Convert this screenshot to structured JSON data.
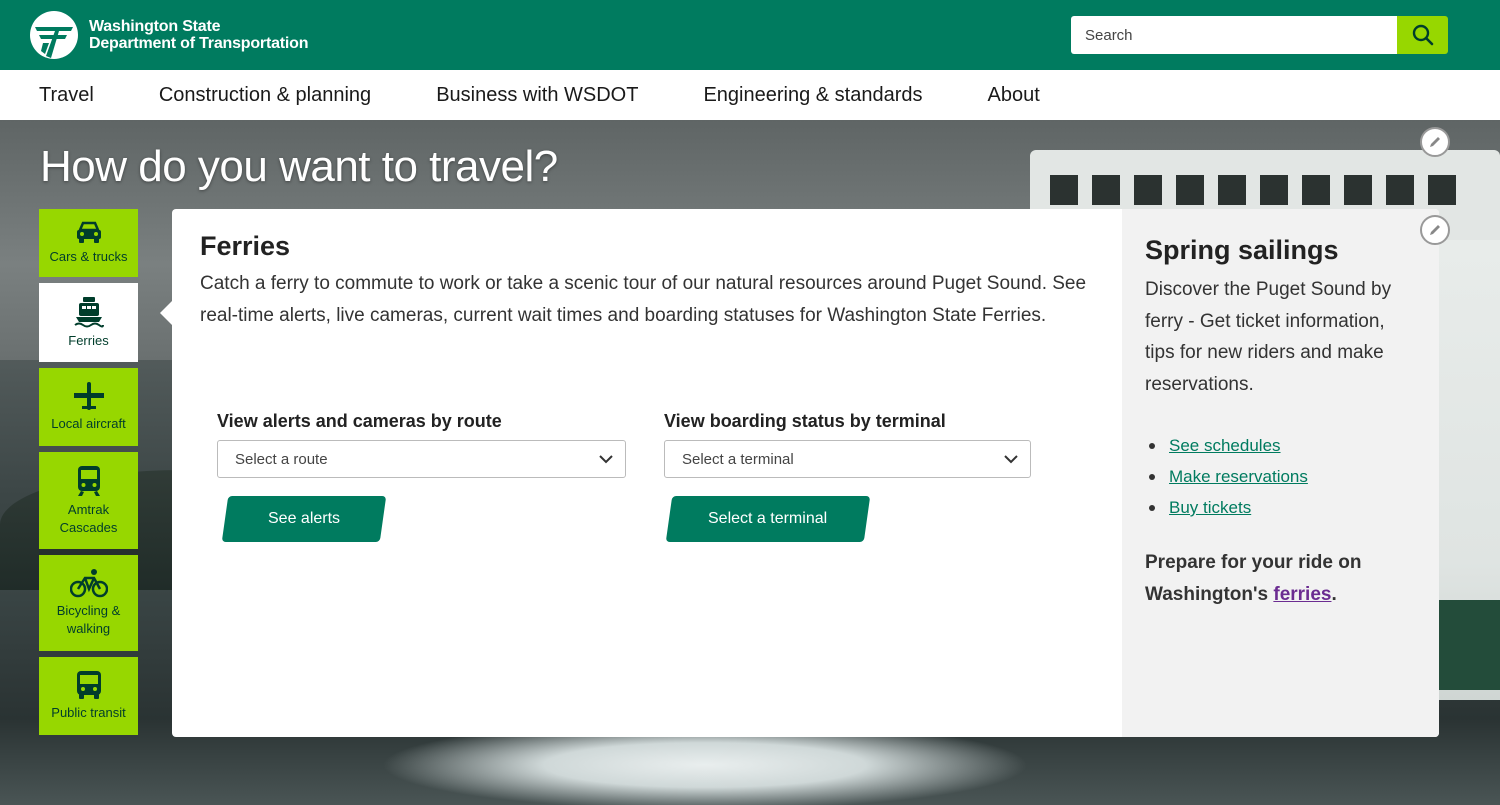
{
  "header": {
    "logo_line1": "Washington State",
    "logo_line2": "Department of Transportation",
    "search_placeholder": "Search",
    "search_icon": "search-icon"
  },
  "nav": {
    "items": [
      {
        "label": "Travel"
      },
      {
        "label": "Construction & planning"
      },
      {
        "label": "Business with WSDOT"
      },
      {
        "label": "Engineering & standards"
      },
      {
        "label": "About"
      }
    ]
  },
  "hero": {
    "title": "How do you want to travel?"
  },
  "modes": [
    {
      "label": "Cars & trucks",
      "icon": "car-icon"
    },
    {
      "label": "Ferries",
      "icon": "ferry-icon",
      "active": true
    },
    {
      "label": "Local aircraft",
      "icon": "airplane-icon"
    },
    {
      "label_line1": "Amtrak",
      "label_line2": "Cascades",
      "icon": "train-icon"
    },
    {
      "label_line1": "Bicycling &",
      "label_line2": "walking",
      "icon": "bicycle-icon"
    },
    {
      "label": "Public transit",
      "icon": "bus-icon"
    }
  ],
  "panel": {
    "title": "Ferries",
    "description": "Catch a ferry to commute to work or take a scenic tour of our natural resources around Puget Sound. See real-time alerts, live cameras, current wait times and boarding statuses for Washington State Ferries.",
    "route": {
      "label": "View alerts and cameras by route",
      "placeholder": "Select a route",
      "button": "See alerts"
    },
    "terminal": {
      "label": "View boarding status by terminal",
      "placeholder": "Select a terminal",
      "button": "Select a terminal"
    }
  },
  "side": {
    "title": "Spring sailings",
    "text": "Discover the Puget Sound by ferry - Get ticket information, tips for new riders and make reservations.",
    "links": [
      {
        "label": "See schedules"
      },
      {
        "label": "Make reservations"
      },
      {
        "label": "Buy tickets"
      }
    ],
    "prepare_text": "Prepare for your ride on Washington's",
    "prepare_link": "ferries",
    "prepare_end": "."
  },
  "colors": {
    "brand_green": "#007b5f",
    "lime": "#97d700",
    "link_purple": "#6b2c91"
  }
}
